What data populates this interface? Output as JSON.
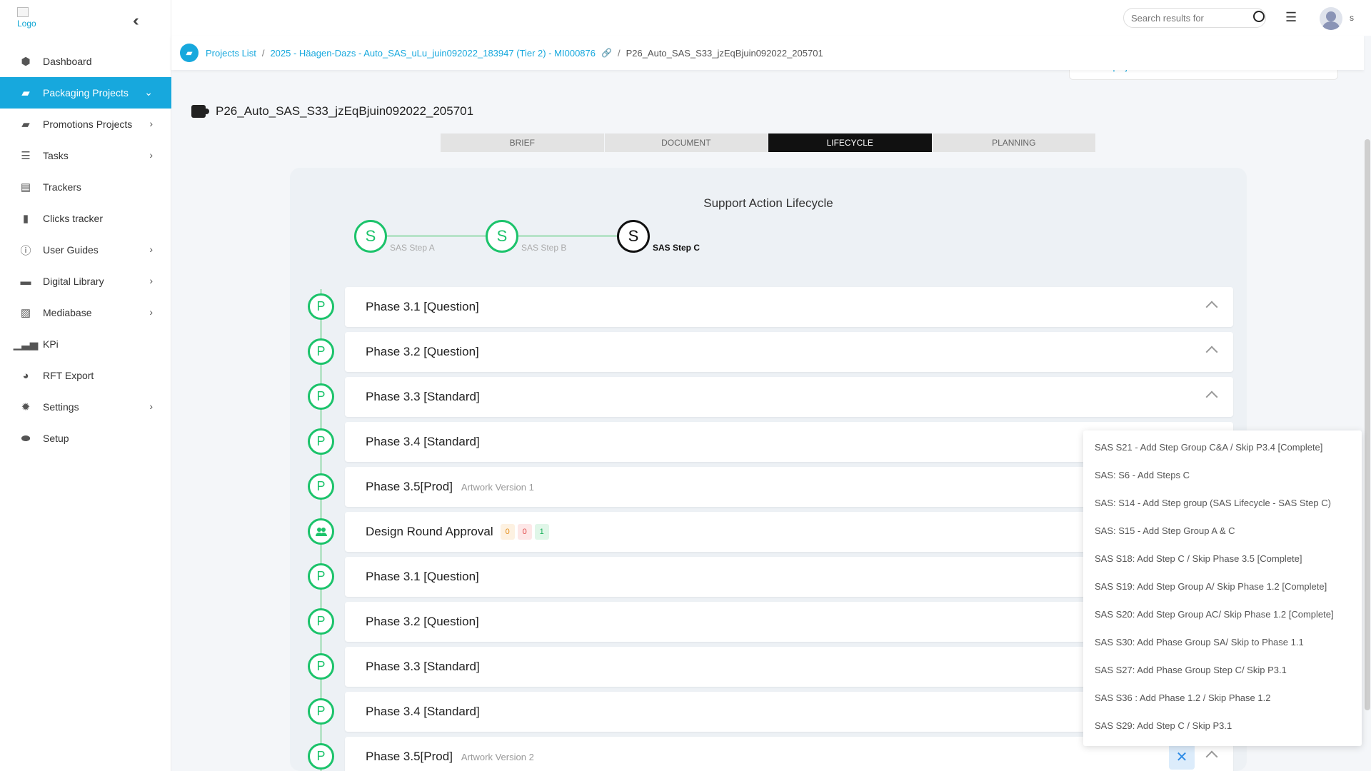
{
  "logo": {
    "alt": "Logo"
  },
  "sidebar": {
    "items": [
      {
        "label": "Dashboard"
      },
      {
        "label": "Packaging Projects"
      },
      {
        "label": "Promotions Projects"
      },
      {
        "label": "Tasks"
      },
      {
        "label": "Trackers"
      },
      {
        "label": "Clicks tracker"
      },
      {
        "label": "User Guides"
      },
      {
        "label": "Digital Library"
      },
      {
        "label": "Mediabase"
      },
      {
        "label": "KPi"
      },
      {
        "label": "RFT Export"
      },
      {
        "label": "Settings"
      },
      {
        "label": "Setup"
      }
    ]
  },
  "topbar": {
    "search_placeholder": "Search results for",
    "user_initial": "s"
  },
  "breadcrumb": {
    "projects_list": "Projects List",
    "project": "2025 - Häagen-Dazs - Auto_SAS_uLu_juin092022_183947 (Tier 2) - MI000876",
    "current": "P26_Auto_SAS_S33_jzEqBjuin092022_205701"
  },
  "favorite": {
    "label": "Favorite project"
  },
  "page": {
    "title": "P26_Auto_SAS_S33_jzEqBjuin092022_205701"
  },
  "tabs": [
    {
      "label": "BRIEF"
    },
    {
      "label": "DOCUMENT"
    },
    {
      "label": "LIFECYCLE"
    },
    {
      "label": "PLANNING"
    }
  ],
  "lifecycle": {
    "title": "Support Action Lifecycle",
    "steps": [
      {
        "letter": "S",
        "label": "SAS Step A"
      },
      {
        "letter": "S",
        "label": "SAS Step B"
      },
      {
        "letter": "S",
        "label": "SAS Step C"
      }
    ],
    "phases": [
      {
        "marker": "P",
        "name": "Phase 3.1 [Question]",
        "sub": ""
      },
      {
        "marker": "P",
        "name": "Phase 3.2 [Question]",
        "sub": ""
      },
      {
        "marker": "P",
        "name": "Phase 3.3 [Standard]",
        "sub": ""
      },
      {
        "marker": "P",
        "name": "Phase 3.4 [Standard]",
        "sub": ""
      },
      {
        "marker": "P",
        "name": "Phase 3.5[Prod]",
        "sub": "Artwork Version 1"
      },
      {
        "marker": "",
        "name": "Design Round Approval",
        "sub": "",
        "badges": [
          "0",
          "0",
          "1"
        ]
      },
      {
        "marker": "P",
        "name": "Phase 3.1 [Question]",
        "sub": ""
      },
      {
        "marker": "P",
        "name": "Phase 3.2 [Question]",
        "sub": ""
      },
      {
        "marker": "P",
        "name": "Phase 3.3 [Standard]",
        "sub": ""
      },
      {
        "marker": "P",
        "name": "Phase 3.4 [Standard]",
        "sub": ""
      },
      {
        "marker": "P",
        "name": "Phase 3.5[Prod]",
        "sub": "Artwork Version 2"
      }
    ]
  },
  "dropdown": {
    "items": [
      "SAS S21 - Add Step Group C&A / Skip P3.4 [Complete]",
      "SAS: S6 - Add Steps C",
      "SAS: S14 - Add Step group (SAS Lifecycle - SAS Step C)",
      "SAS: S15 - Add Step Group A & C",
      "SAS S18: Add Step C / Skip Phase 3.5 [Complete]",
      "SAS S19: Add Step Group A/ Skip Phase 1.2 [Complete]",
      "SAS S20: Add Step Group AC/ Skip Phase 1.2 [Complete]",
      "SAS S30: Add Phase Group SA/ Skip to Phase 1.1",
      "SAS S27: Add Phase Group Step C/ Skip P3.1",
      "SAS S36 : Add Phase 1.2 / Skip Phase 1.2",
      "SAS S29: Add Step C / Skip P3.1"
    ]
  },
  "colors": {
    "accent": "#17a8dd",
    "success": "#1cc36b",
    "dark": "#111111"
  }
}
